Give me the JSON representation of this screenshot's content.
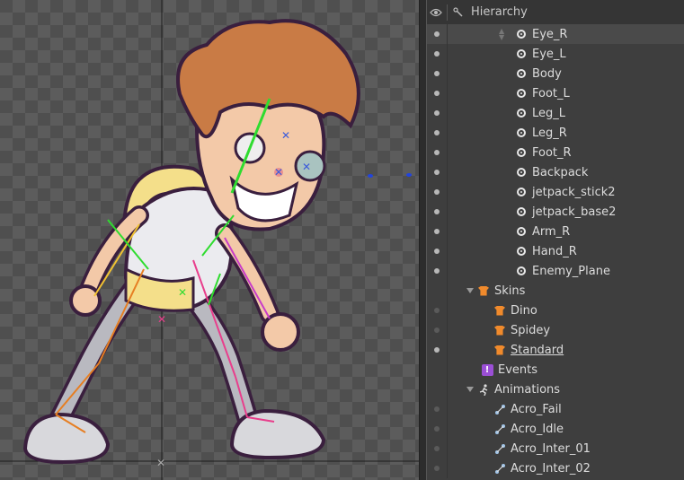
{
  "hierarchy": {
    "title": "Hierarchy",
    "header_icons": [
      "eye-icon",
      "bone-link-icon"
    ],
    "bones": [
      {
        "label": "Eye_R",
        "selected": true
      },
      {
        "label": "Eye_L"
      },
      {
        "label": "Body"
      },
      {
        "label": "Foot_L"
      },
      {
        "label": "Leg_L"
      },
      {
        "label": "Leg_R"
      },
      {
        "label": "Foot_R"
      },
      {
        "label": "Backpack"
      },
      {
        "label": "jetpack_stick2"
      },
      {
        "label": "jetpack_base2"
      },
      {
        "label": "Arm_R"
      },
      {
        "label": "Hand_R"
      },
      {
        "label": "Enemy_Plane"
      }
    ],
    "skins": {
      "label": "Skins",
      "items": [
        {
          "label": "Dino"
        },
        {
          "label": "Spidey"
        },
        {
          "label": "Standard",
          "active": true
        }
      ]
    },
    "events": {
      "label": "Events"
    },
    "animations": {
      "label": "Animations",
      "items": [
        {
          "label": "Acro_Fail"
        },
        {
          "label": "Acro_Idle"
        },
        {
          "label": "Acro_Inter_01"
        },
        {
          "label": "Acro_Inter_02"
        }
      ]
    }
  },
  "colors": {
    "skin_icon": "#f08a2c",
    "events_icon": "#9b4fd6",
    "panel_bg": "#3e3e3e",
    "viewport_checker": "#4f4f4f"
  }
}
